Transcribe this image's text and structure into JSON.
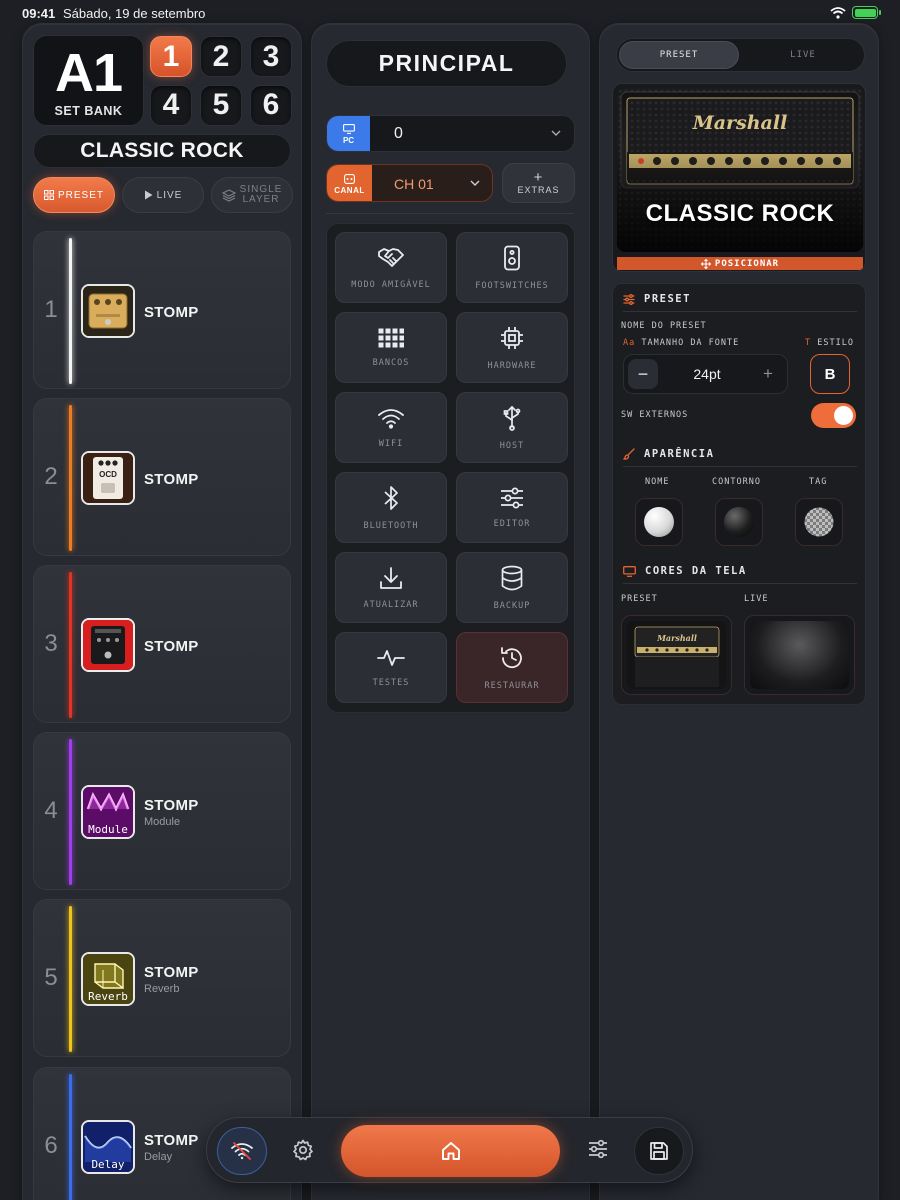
{
  "status": {
    "time": "09:41",
    "date": "Sábado, 19 de setembro"
  },
  "bank": {
    "code": "A1",
    "sublabel": "SET BANK",
    "buttons": [
      "1",
      "2",
      "3",
      "4",
      "5",
      "6"
    ],
    "active": "1"
  },
  "preset_name": "CLASSIC ROCK",
  "modes": {
    "preset": "PRESET",
    "live": "LIVE",
    "single_line1": "SINGLE",
    "single_line2": "LAYER"
  },
  "stomps": [
    {
      "num": "1",
      "name": "STOMP",
      "sub": "",
      "color": "#f4f4f4"
    },
    {
      "num": "2",
      "name": "STOMP",
      "sub": "",
      "color": "#f07c22"
    },
    {
      "num": "3",
      "name": "STOMP",
      "sub": "",
      "color": "#e23325"
    },
    {
      "num": "4",
      "name": "STOMP",
      "sub": "Module",
      "thumb_text": "Module",
      "color": "#a23cf0"
    },
    {
      "num": "5",
      "name": "STOMP",
      "sub": "Reverb",
      "thumb_text": "Reverb",
      "color": "#f0c419"
    },
    {
      "num": "6",
      "name": "STOMP",
      "sub": "Delay",
      "thumb_text": "Delay",
      "color": "#3a6cf0"
    }
  ],
  "middle": {
    "title": "PRINCIPAL",
    "pc": {
      "tag": "PC",
      "value": "0"
    },
    "canal": {
      "tag": "CANAL",
      "value": "CH 01"
    },
    "extras": "EXTRAS",
    "tiles": [
      {
        "label": "MODO AMIGÁVEL",
        "icon": "handshake-icon"
      },
      {
        "label": "FOOTSWITCHES",
        "icon": "footswitch-icon"
      },
      {
        "label": "BANCOS",
        "icon": "grid-icon"
      },
      {
        "label": "HARDWARE",
        "icon": "chip-icon"
      },
      {
        "label": "WIFI",
        "icon": "wifi-icon"
      },
      {
        "label": "HOST",
        "icon": "usb-icon"
      },
      {
        "label": "BLUETOOTH",
        "icon": "bluetooth-icon"
      },
      {
        "label": "EDITOR",
        "icon": "sliders-icon"
      },
      {
        "label": "ATUALIZAR",
        "icon": "download-icon"
      },
      {
        "label": "BACKUP",
        "icon": "database-icon"
      },
      {
        "label": "TESTES",
        "icon": "pulse-icon"
      },
      {
        "label": "RESTAURAR",
        "icon": "restore-icon"
      }
    ]
  },
  "right": {
    "seg_preset": "PRESET",
    "seg_live": "LIVE",
    "amp_brand": "Marshall",
    "amp_title": "CLASSIC ROCK",
    "posicionar": "POSICIONAR",
    "preset_section": "PRESET",
    "nome_do_preset": "NOME DO PRESET",
    "tamanho_icon": "Aa",
    "tamanho_label": "TAMANHO DA FONTE",
    "estilo_icon": "T",
    "estilo_label": "ESTILO",
    "font_size": "24pt",
    "bold_label": "B",
    "sw_externos": "SW EXTERNOS",
    "sw_externos_on": true,
    "aparencia": "APARÊNCIA",
    "nome": "NOME",
    "contorno": "CONTORNO",
    "tag": "TAG",
    "cores": "CORES DA TELA",
    "preset_thumb": "PRESET",
    "live_thumb": "LIVE",
    "accent": "#e2642f"
  }
}
